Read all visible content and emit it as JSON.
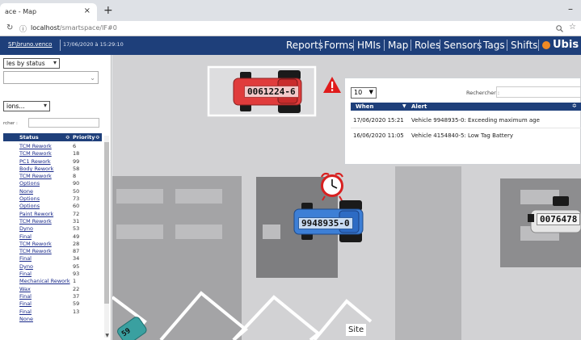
{
  "browser": {
    "tab_title": "ace - Map",
    "tab_close": "×",
    "new_tab": "+",
    "url_host": "localhost",
    "url_path": "/smartspace/IF#0",
    "minimize": "–"
  },
  "navbar": {
    "user": "SF\\bruno.venco",
    "timestamp": "17/06/2020 à 15:29:10",
    "items": [
      "Reports",
      "Forms",
      "HMIs",
      "Map",
      "Roles",
      "Sensors",
      "Tags",
      "Shifts"
    ],
    "brand": "Ubis"
  },
  "sidebar": {
    "filter_select": "les by status",
    "options_select": "ions...",
    "search_label": "rcher :",
    "headers": {
      "status": "Status",
      "priority": "Priority",
      "sort": "≎"
    },
    "rows": [
      {
        "status": "TCM Rework",
        "priority": "6"
      },
      {
        "status": "TCM Rework",
        "priority": "18"
      },
      {
        "status": "PC1 Rework",
        "priority": "99"
      },
      {
        "status": "Body Rework",
        "priority": "58"
      },
      {
        "status": "TCM Rework",
        "priority": "8"
      },
      {
        "status": "Options",
        "priority": "90"
      },
      {
        "status": "None",
        "priority": "50"
      },
      {
        "status": "Options",
        "priority": "73"
      },
      {
        "status": "Options",
        "priority": "60"
      },
      {
        "status": "Paint Rework",
        "priority": "72"
      },
      {
        "status": "TCM Rework",
        "priority": "31"
      },
      {
        "status": "Dyno",
        "priority": "53"
      },
      {
        "status": "Final",
        "priority": "49"
      },
      {
        "status": "TCM Rework",
        "priority": "28"
      },
      {
        "status": "TCM Rework",
        "priority": "87"
      },
      {
        "status": "Final",
        "priority": "34"
      },
      {
        "status": "Dyno",
        "priority": "95"
      },
      {
        "status": "Final",
        "priority": "93"
      },
      {
        "status": "Mechanical Rework",
        "priority": "1"
      },
      {
        "status": "Wax",
        "priority": "22"
      },
      {
        "status": "Final",
        "priority": "37"
      },
      {
        "status": "Final",
        "priority": "59"
      },
      {
        "status": "Final",
        "priority": "13"
      },
      {
        "status": "None",
        "priority": ""
      }
    ]
  },
  "map": {
    "vehicles": [
      {
        "id": "0061224-6",
        "color": "#e03c3c"
      },
      {
        "id": "9948935-0",
        "color": "#3d7fd6"
      },
      {
        "id": "0076478",
        "color": "#dcdcdc"
      },
      {
        "id": "59",
        "color": "#3aa0a0"
      }
    ],
    "warning_icon": "warning-triangle-icon",
    "clock_icon": "alarm-clock-icon",
    "site_label": "Site"
  },
  "alerts_panel": {
    "page_size": "10",
    "search_label": "Rechercher :",
    "headers": {
      "when": "When",
      "alert": "Alert"
    },
    "rows": [
      {
        "when": "17/06/2020 15:21",
        "alert": "Vehicle 9948935-0: Exceeding maximum age"
      },
      {
        "when": "16/06/2020 11:05",
        "alert": "Vehicle 4154840-5: Low Tag Battery"
      }
    ]
  }
}
